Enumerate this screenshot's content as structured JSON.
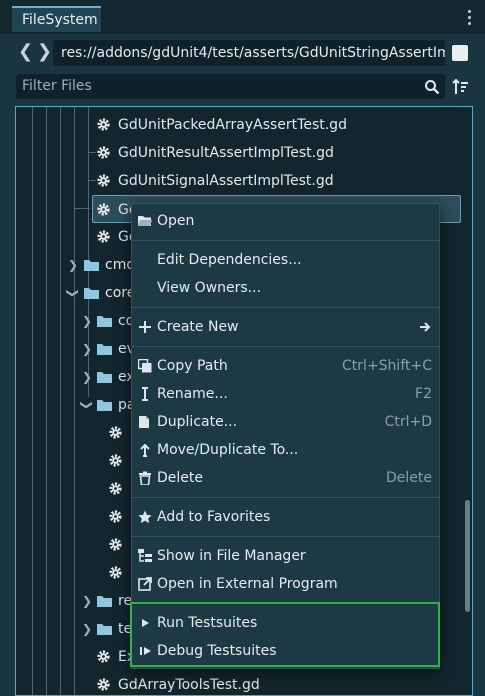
{
  "panel": {
    "tab_label": "FileSystem"
  },
  "path_bar": {
    "back": "❮",
    "forward": "❯",
    "path": "res://addons/gdUnit4/test/asserts/GdUnitStringAssertIm"
  },
  "filter": {
    "placeholder": "Filter Files"
  },
  "tree": {
    "rows": [
      {
        "label": "GdUnitPackedArrayAssertTest.gd"
      },
      {
        "label": "GdUnitResultAssertImplTest.gd"
      },
      {
        "label": "GdUnitSignalAssertImplTest.gd"
      },
      {
        "label": "GdUnitStringAssertImplTest.gd"
      },
      {
        "label": "Gd"
      },
      {
        "label": "cmd"
      },
      {
        "label": "core"
      },
      {
        "label": "co"
      },
      {
        "label": "ev"
      },
      {
        "label": "ex"
      },
      {
        "label": "pa"
      },
      {
        "label": "re"
      },
      {
        "label": "te"
      },
      {
        "label": "Ex"
      },
      {
        "label": "GdArrayToolsTest.gd"
      }
    ]
  },
  "context_menu": {
    "open": "Open",
    "edit_dependencies": "Edit Dependencies...",
    "view_owners": "View Owners...",
    "create_new": "Create New",
    "copy_path": "Copy Path",
    "copy_path_shortcut": "Ctrl+Shift+C",
    "rename": "Rename...",
    "rename_shortcut": "F2",
    "duplicate": "Duplicate...",
    "duplicate_shortcut": "Ctrl+D",
    "move_duplicate": "Move/Duplicate To...",
    "delete": "Delete",
    "delete_shortcut": "Delete",
    "add_favorites": "Add to Favorites",
    "show_file_manager": "Show in File Manager",
    "open_external": "Open in External Program",
    "run_testsuites": "Run Testsuites",
    "debug_testsuites": "Debug Testsuites"
  },
  "colors": {
    "accent": "#56a7c4",
    "highlight": "#2fb24a",
    "background": "#1a3540"
  }
}
